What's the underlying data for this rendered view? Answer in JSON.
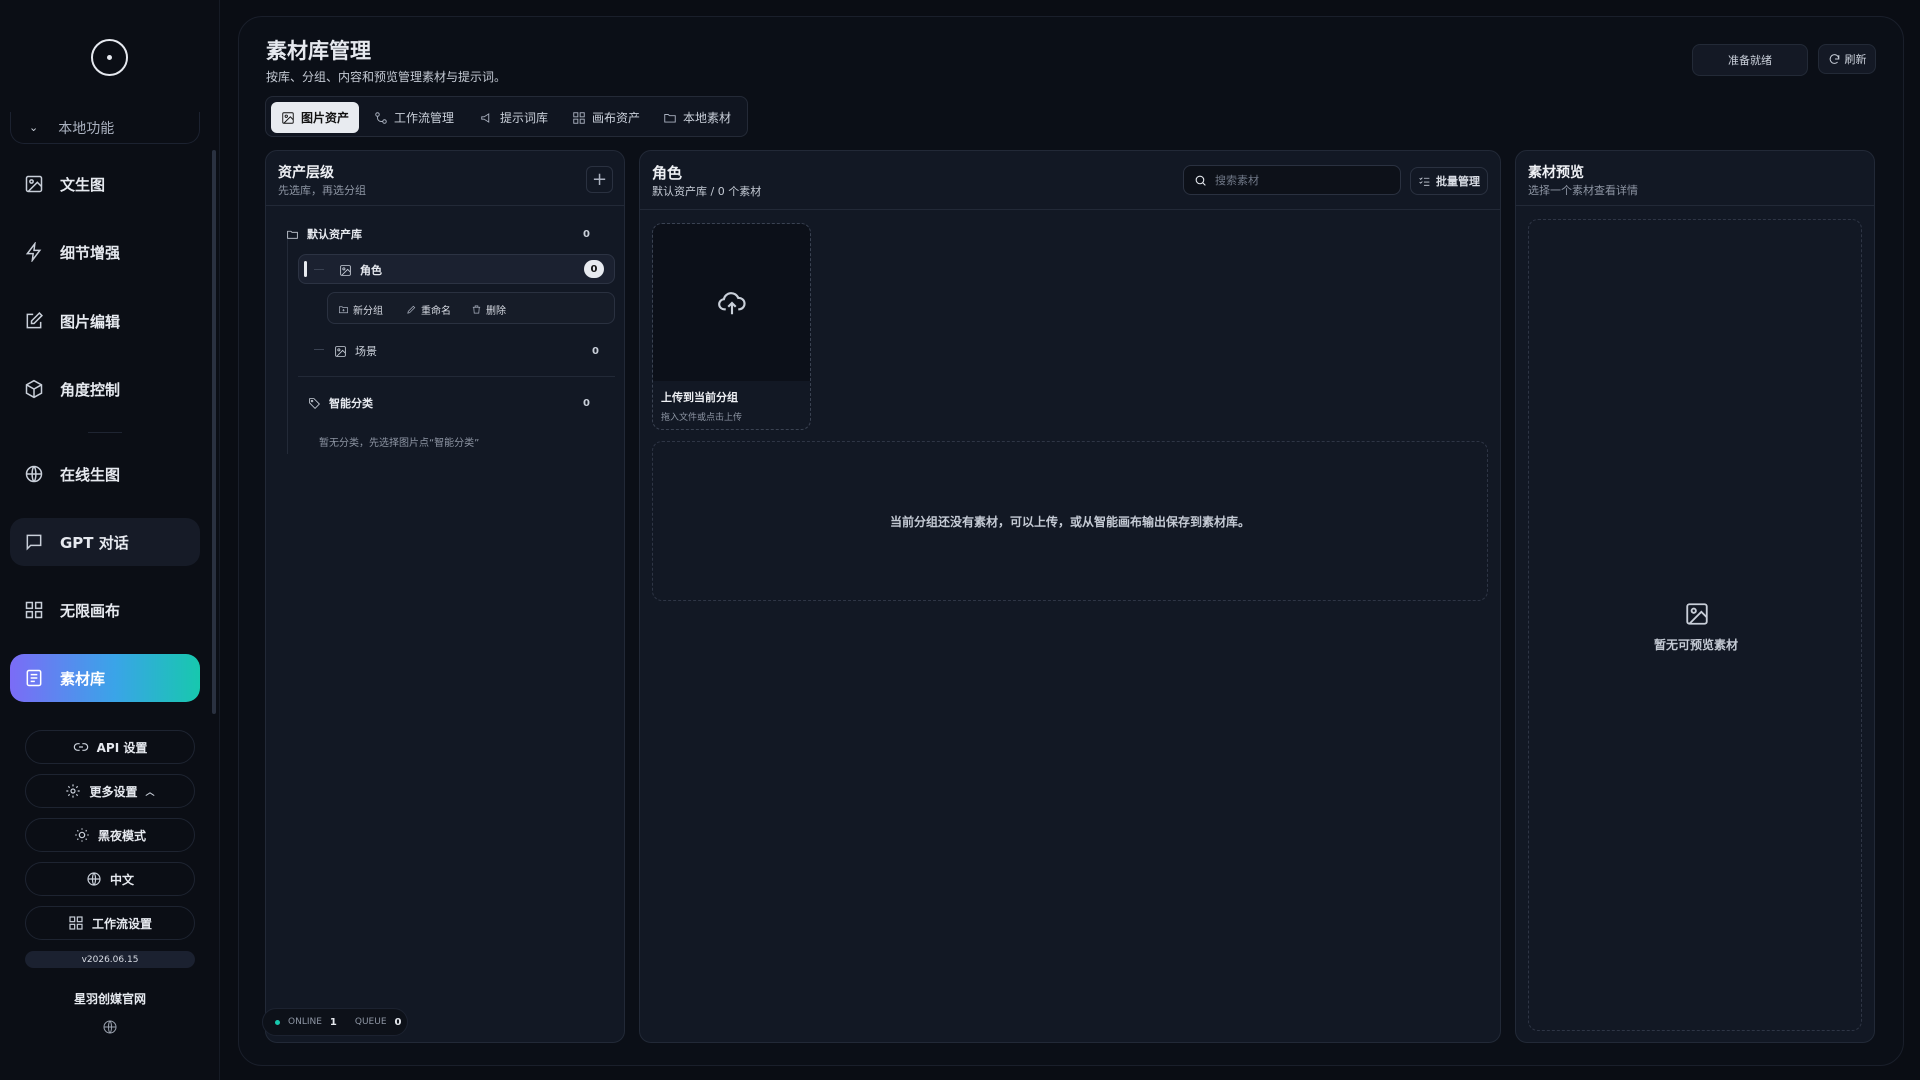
{
  "sidebar": {
    "local_label": "本地功能",
    "items": [
      {
        "label": "文生图",
        "icon": "image-icon"
      },
      {
        "label": "细节增强",
        "icon": "lightning-icon"
      },
      {
        "label": "图片编辑",
        "icon": "edit-icon"
      },
      {
        "label": "角度控制",
        "icon": "cube-icon"
      },
      {
        "label": "在线生图",
        "icon": "globe-icon"
      },
      {
        "label": "GPT 对话",
        "icon": "chat-icon"
      },
      {
        "label": "无限画布",
        "icon": "grid-icon"
      },
      {
        "label": "素材库",
        "icon": "library-icon"
      }
    ],
    "api_settings": "API 设置",
    "more_settings": "更多设置",
    "dark_mode": "黑夜模式",
    "language": "中文",
    "workflow_settings": "工作流设置",
    "version": "v2026.06.15",
    "brand": "星羽创媒官网"
  },
  "header": {
    "title": "素材库管理",
    "subtitle": "按库、分组、内容和预览管理素材与提示词。",
    "status": "准备就绪",
    "refresh": "刷新"
  },
  "tabs": [
    {
      "label": "图片资产",
      "active": true
    },
    {
      "label": "工作流管理"
    },
    {
      "label": "提示词库"
    },
    {
      "label": "画布资产"
    },
    {
      "label": "本地素材"
    }
  ],
  "hierarchy": {
    "title": "资产层级",
    "subtitle": "先选库，再选分组",
    "library": {
      "name": "默认资产库",
      "count": "0"
    },
    "groups": [
      {
        "name": "角色",
        "count": "0"
      },
      {
        "name": "场景",
        "count": "0"
      }
    ],
    "actions": {
      "new_group": "新分组",
      "rename": "重命名",
      "delete": "删除"
    },
    "smart": {
      "name": "智能分类",
      "count": "0",
      "empty": "暂无分类，先选择图片点“智能分类”"
    }
  },
  "content": {
    "title": "角色",
    "subtitle": "默认资产库 / 0 个素材",
    "search_placeholder": "搜索素材",
    "batch": "批量管理",
    "upload_title": "上传到当前分组",
    "upload_sub": "拖入文件或点击上传",
    "empty": "当前分组还没有素材，可以上传，或从智能画布输出保存到素材库。"
  },
  "preview": {
    "title": "素材预览",
    "subtitle": "选择一个素材查看详情",
    "empty": "暂无可预览素材"
  },
  "footer": {
    "online_label": "ONLINE",
    "online": "1",
    "queue_label": "QUEUE",
    "queue": "0"
  }
}
